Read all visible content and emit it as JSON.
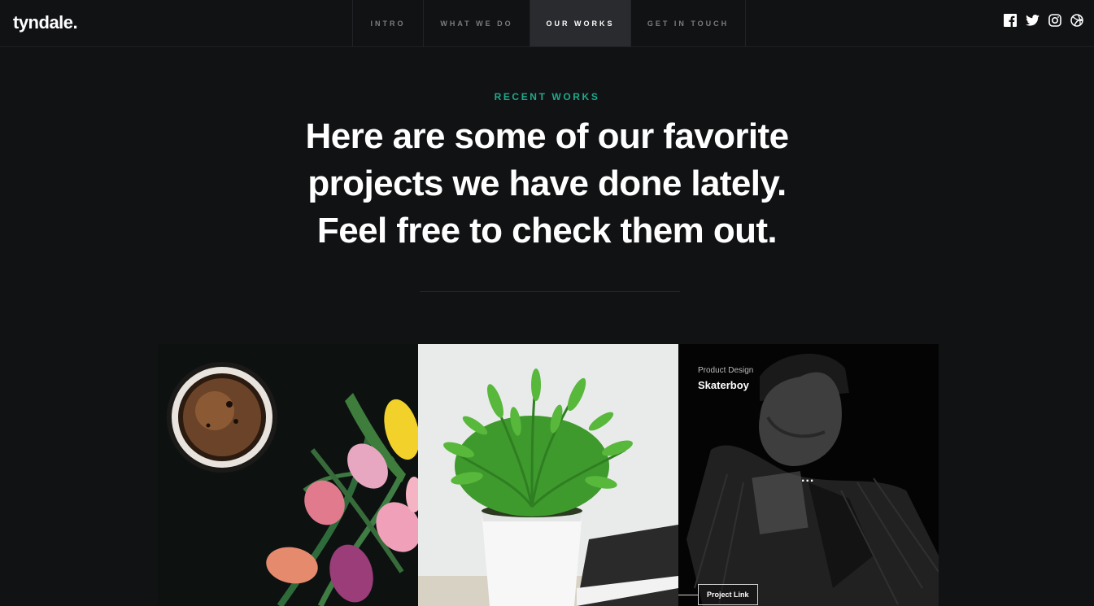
{
  "brand": {
    "logo": "tyndale."
  },
  "nav": [
    {
      "label": "INTRO",
      "active": false
    },
    {
      "label": "WHAT WE DO",
      "active": false
    },
    {
      "label": "OUR WORKS",
      "active": true
    },
    {
      "label": "GET IN TOUCH",
      "active": false
    }
  ],
  "social": [
    "facebook-icon",
    "twitter-icon",
    "instagram-icon",
    "dribbble-icon"
  ],
  "section": {
    "eyebrow": "RECENT WORKS",
    "headline": "Here are some of our favorite projects we have done lately. Feel free to check them out."
  },
  "works": [
    {
      "image": "coffee-and-tulips"
    },
    {
      "image": "potted-plant"
    },
    {
      "image": "skater-portrait",
      "category": "Product Design",
      "title": "Skaterboy",
      "more": "...",
      "link": "Project Link"
    }
  ],
  "colors": {
    "accent": "#1fa88c",
    "background": "#111214",
    "active_nav": "#2a2b2e"
  }
}
